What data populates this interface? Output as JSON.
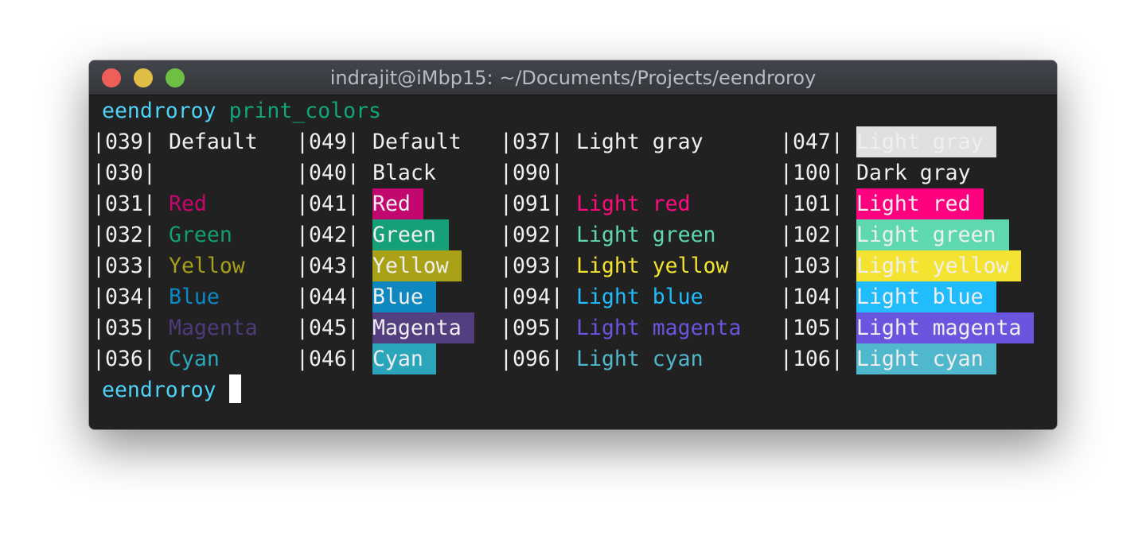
{
  "window": {
    "title": "indrajit@iMbp15: ~/Documents/Projects/eendroroy",
    "buttons": [
      {
        "name": "close",
        "color": "#ee5f58"
      },
      {
        "name": "minimize",
        "color": "#e0bd47"
      },
      {
        "name": "zoom",
        "color": "#6ec044"
      }
    ]
  },
  "prompt": {
    "dir": "eendroroy",
    "command": "print_colors",
    "dir_color": "#4fd2f7",
    "command_color": "#10a57a"
  },
  "columns": [
    {
      "rows": [
        {
          "code": "|039|",
          "label": "Default",
          "fg": "#efefef"
        },
        {
          "code": "|030|",
          "label": "",
          "fg": "#212121"
        },
        {
          "code": "|031|",
          "label": "Red",
          "fg": "#c7076f"
        },
        {
          "code": "|032|",
          "label": "Green",
          "fg": "#139f72"
        },
        {
          "code": "|033|",
          "label": "Yellow",
          "fg": "#a89f1a"
        },
        {
          "code": "|034|",
          "label": "Blue",
          "fg": "#0b8ac5"
        },
        {
          "code": "|035|",
          "label": "Magenta",
          "fg": "#4e3b7c"
        },
        {
          "code": "|036|",
          "label": "Cyan",
          "fg": "#2aa7b9"
        }
      ]
    },
    {
      "rows": [
        {
          "code": "|049|",
          "label": "Default"
        },
        {
          "code": "|040|",
          "label": "Black",
          "bg": "#212121"
        },
        {
          "code": "|041|",
          "label": "Red",
          "bg": "#c2076e"
        },
        {
          "code": "|042|",
          "label": "Green",
          "bg": "#16a079"
        },
        {
          "code": "|043|",
          "label": "Yellow",
          "bg": "#a9a116"
        },
        {
          "code": "|044|",
          "label": "Blue",
          "bg": "#0f88c0"
        },
        {
          "code": "|045|",
          "label": "Magenta",
          "bg": "#533f80"
        },
        {
          "code": "|046|",
          "label": "Cyan",
          "bg": "#2aa5ba"
        }
      ]
    },
    {
      "rows": [
        {
          "code": "|037|",
          "label": "Light gray",
          "fg": "#efefef"
        },
        {
          "code": "|090|",
          "label": "",
          "fg": "#212121"
        },
        {
          "code": "|091|",
          "label": "Light red",
          "fg": "#ff0a7f"
        },
        {
          "code": "|092|",
          "label": "Light green",
          "fg": "#5ed8b0"
        },
        {
          "code": "|093|",
          "label": "Light yellow",
          "fg": "#f4e431"
        },
        {
          "code": "|094|",
          "label": "Light blue",
          "fg": "#20bcfc"
        },
        {
          "code": "|095|",
          "label": "Light magenta",
          "fg": "#6a55de"
        },
        {
          "code": "|096|",
          "label": "Light cyan",
          "fg": "#50b8cc"
        }
      ]
    },
    {
      "rows": [
        {
          "code": "|047|",
          "label": "Light gray",
          "bg": "#e0e0e0"
        },
        {
          "code": "|100|",
          "label": "Dark gray",
          "bg": "#212121"
        },
        {
          "code": "|101|",
          "label": "Light red",
          "bg": "#ff007f"
        },
        {
          "code": "|102|",
          "label": "Light green",
          "bg": "#5ed8b0"
        },
        {
          "code": "|103|",
          "label": "Light yellow",
          "bg": "#f4e431"
        },
        {
          "code": "|104|",
          "label": "Light blue",
          "bg": "#20bcfc"
        },
        {
          "code": "|105|",
          "label": "Light magenta",
          "bg": "#6a55de"
        },
        {
          "code": "|106|",
          "label": "Light cyan",
          "bg": "#50b8cc"
        }
      ]
    }
  ],
  "final_prompt": {
    "dir": "eendroroy"
  }
}
